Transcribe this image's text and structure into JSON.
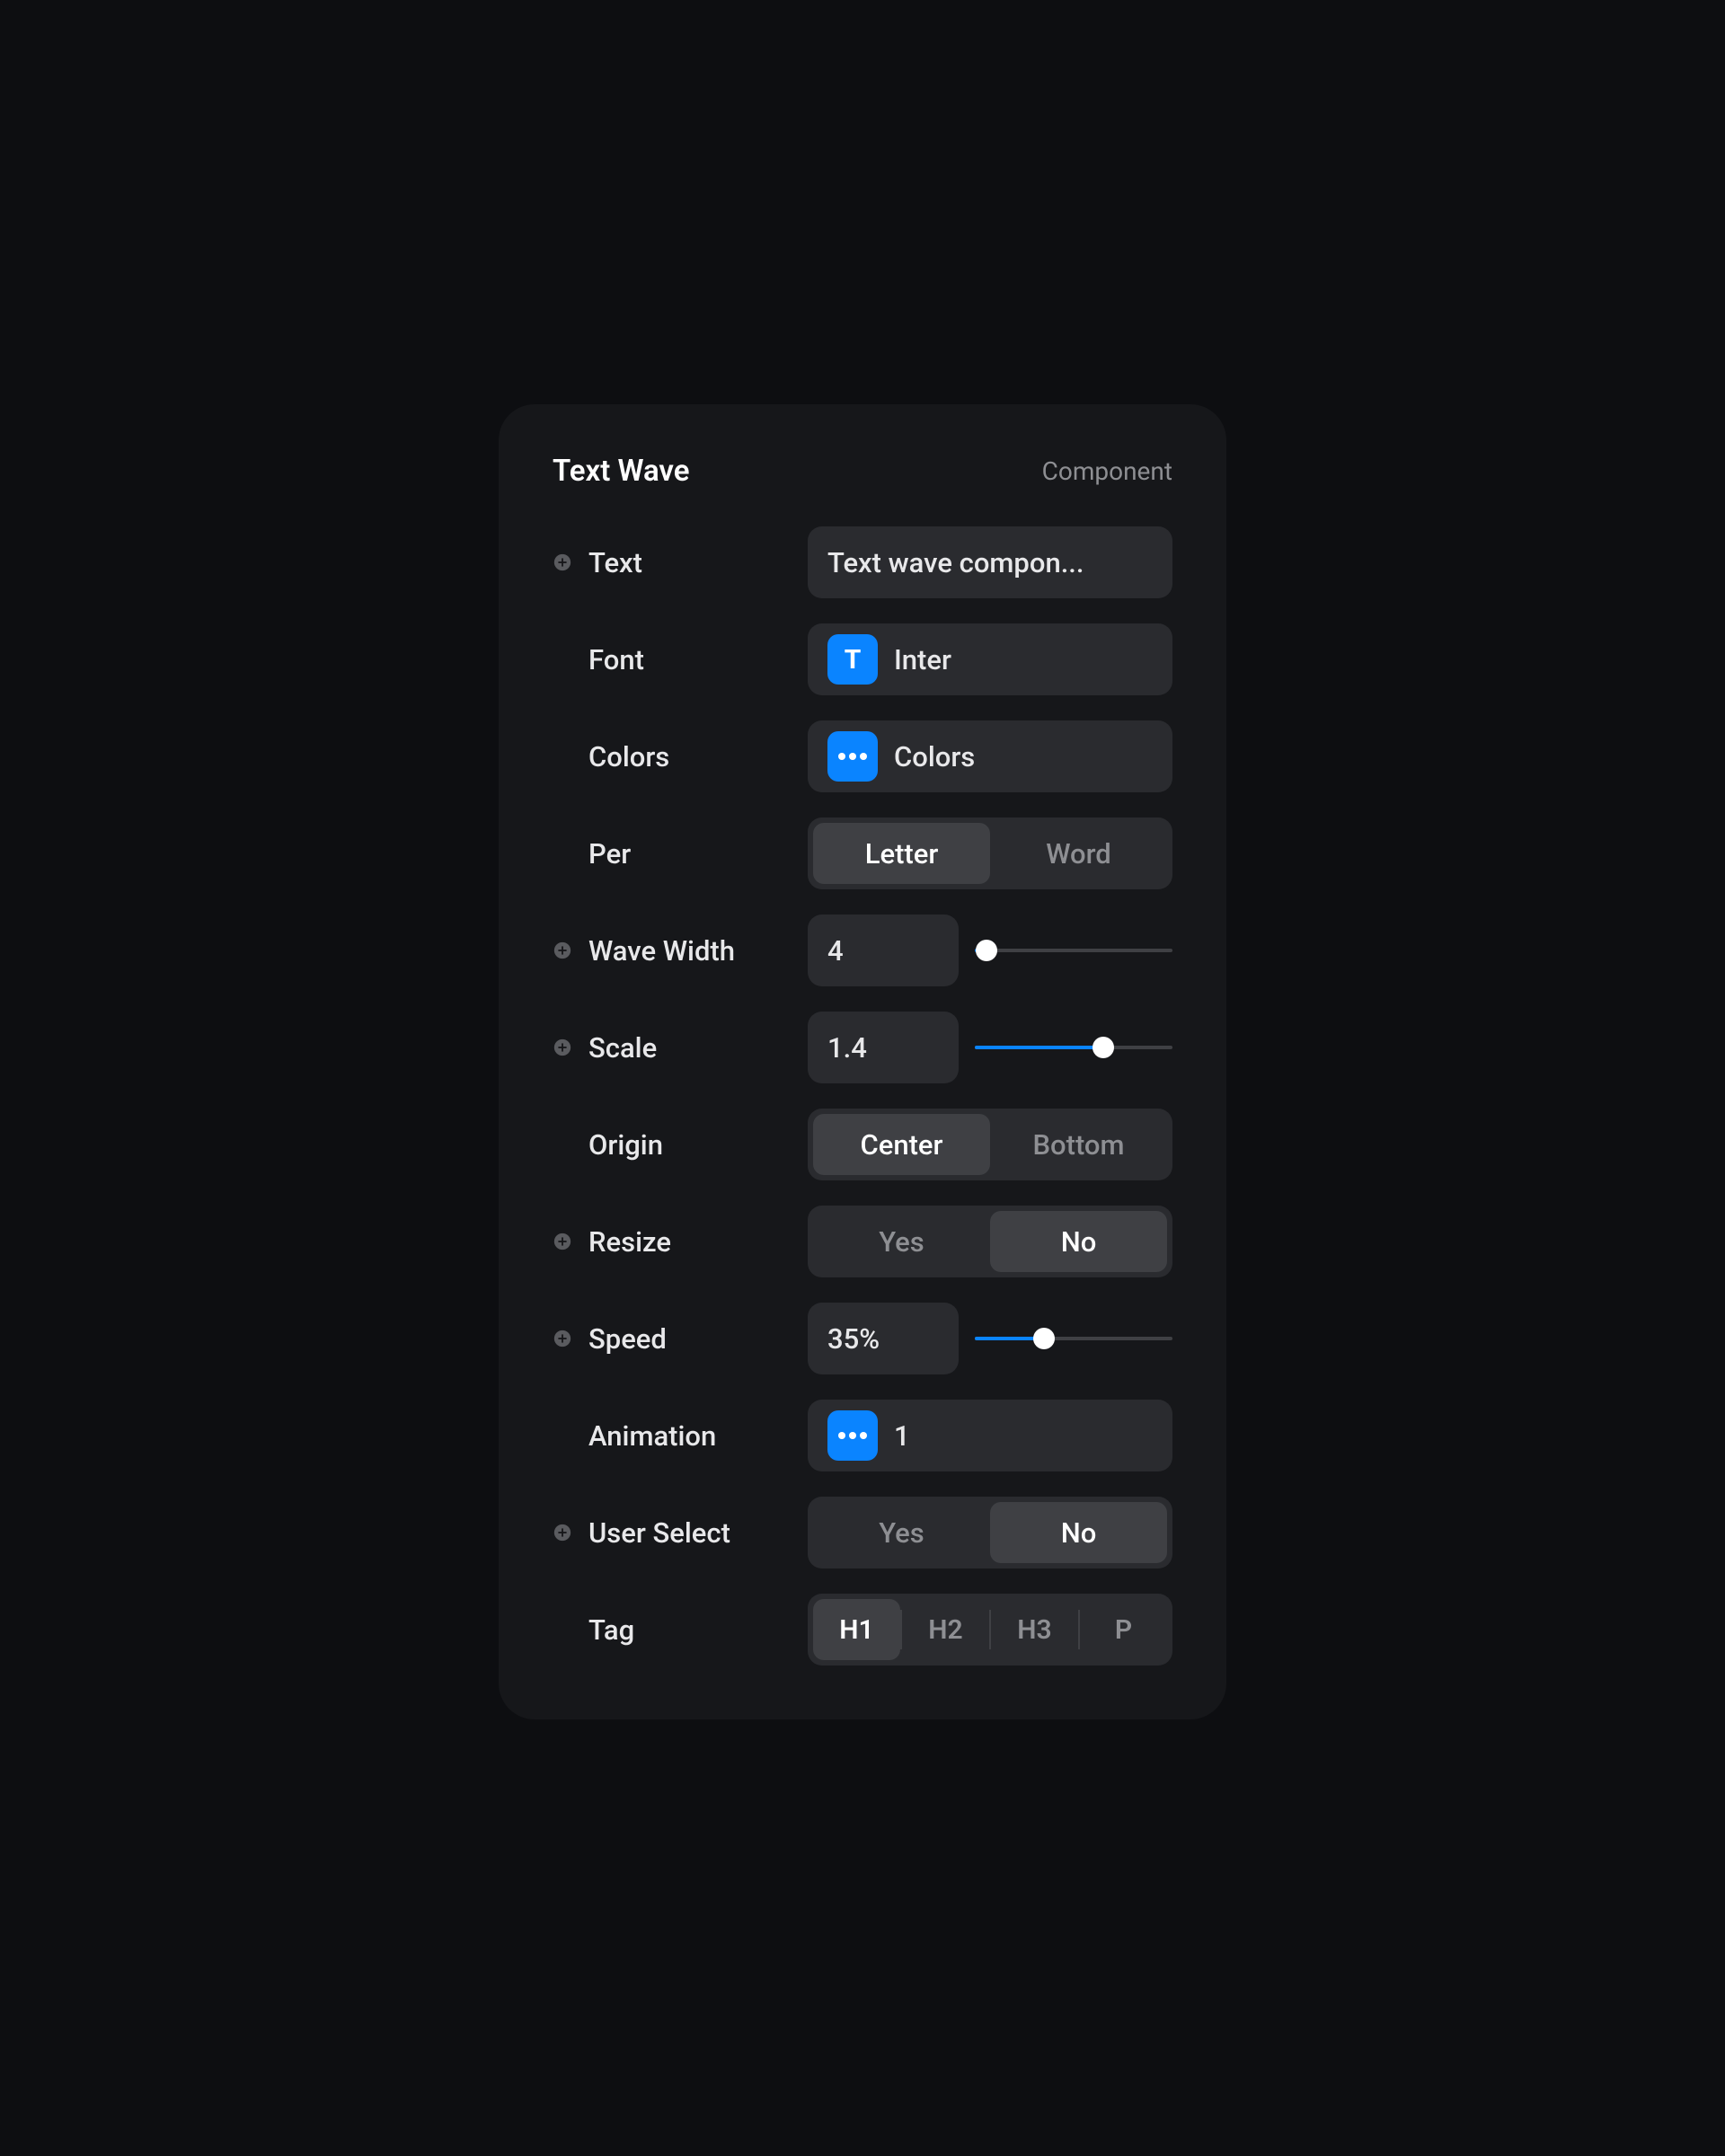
{
  "header": {
    "title": "Text Wave",
    "subtitle": "Component"
  },
  "rows": {
    "text": {
      "label": "Text",
      "value": "Text wave compon..."
    },
    "font": {
      "label": "Font",
      "value": "Inter"
    },
    "colors": {
      "label": "Colors",
      "value": "Colors"
    },
    "per": {
      "label": "Per",
      "options": [
        "Letter",
        "Word"
      ],
      "active": "Letter"
    },
    "waveWidth": {
      "label": "Wave Width",
      "value": "4",
      "sliderPercent": 6
    },
    "scale": {
      "label": "Scale",
      "value": "1.4",
      "sliderPercent": 65
    },
    "origin": {
      "label": "Origin",
      "options": [
        "Center",
        "Bottom"
      ],
      "active": "Center"
    },
    "resize": {
      "label": "Resize",
      "options": [
        "Yes",
        "No"
      ],
      "active": "No"
    },
    "speed": {
      "label": "Speed",
      "value": "35%",
      "sliderPercent": 35
    },
    "animation": {
      "label": "Animation",
      "value": "1"
    },
    "userSelect": {
      "label": "User Select",
      "options": [
        "Yes",
        "No"
      ],
      "active": "No"
    },
    "tag": {
      "label": "Tag",
      "options": [
        "H1",
        "H2",
        "H3",
        "P"
      ],
      "active": "H1"
    }
  }
}
